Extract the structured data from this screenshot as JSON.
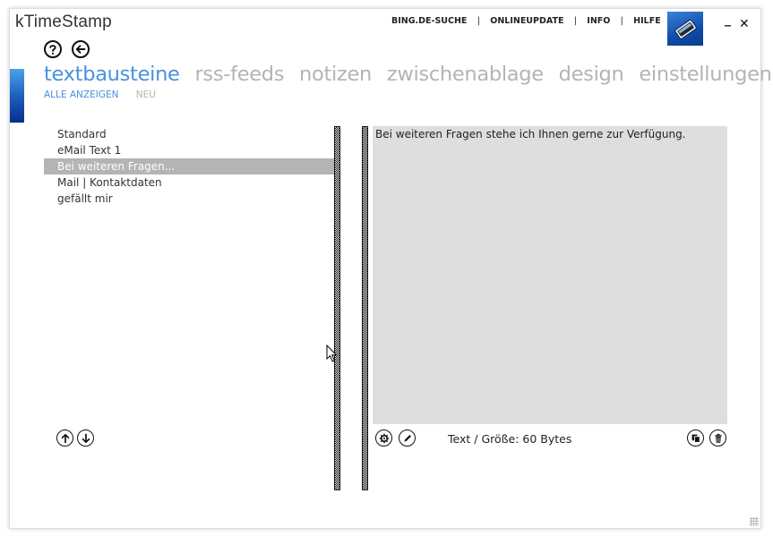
{
  "app": {
    "title": "kTimeStamp"
  },
  "top_nav": {
    "items": [
      "BING.DE-SUCHE",
      "ONLINEUPDATE",
      "INFO",
      "HILFE"
    ],
    "separator": "|"
  },
  "window_controls": {
    "minimize": "_",
    "close": "✕"
  },
  "tabs": {
    "items": [
      "textbausteine",
      "rss-feeds",
      "notizen",
      "zwischenablage",
      "design",
      "einstellungen"
    ],
    "active_index": 0
  },
  "subtabs": {
    "items": [
      "ALLE ANZEIGEN",
      "NEU"
    ],
    "active_index": 0
  },
  "list": {
    "items": [
      "Standard",
      "eMail Text 1",
      "Bei weiteren Fragen...",
      "Mail | Kontaktdaten",
      "gefällt mir"
    ],
    "selected_index": 2
  },
  "editor": {
    "text": "Bei weiteren Fragen stehe ich Ihnen gerne zur Verfügung."
  },
  "footer": {
    "size_label": "Text / Größe: 60 Bytes"
  },
  "icons": {
    "help": "help-icon",
    "back": "back-arrow-icon",
    "move_up": "arrow-up-icon",
    "move_down": "arrow-down-icon",
    "settings": "gear-icon",
    "edit": "pencil-icon",
    "copy": "copy-icon",
    "delete": "trash-icon"
  },
  "colors": {
    "accent": "#4a90e0",
    "inactive_tab": "#b4b4b4",
    "selection": "#b4b4b4",
    "editor_bg": "#dedede",
    "logo_blue": "#1c5fc0"
  }
}
